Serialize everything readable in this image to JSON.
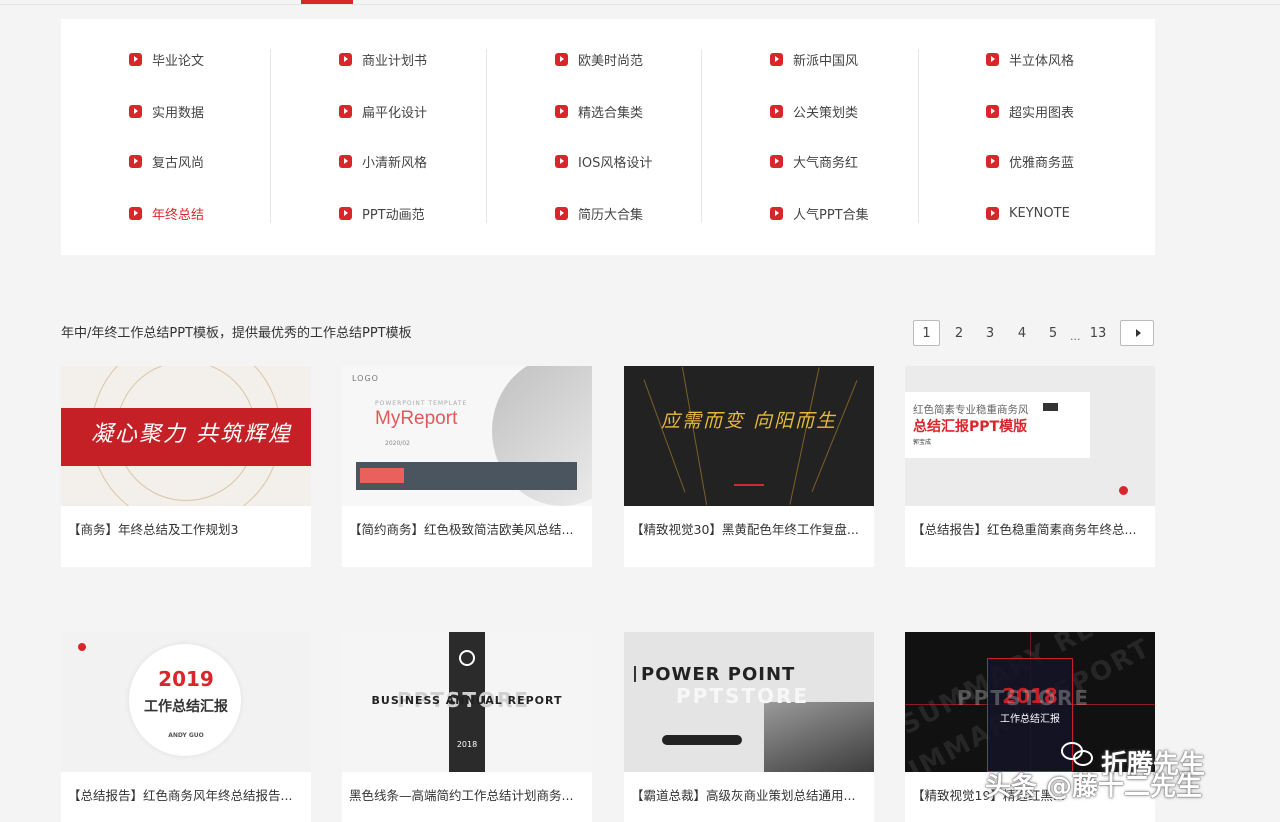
{
  "categories": [
    [
      {
        "label": "毕业论文"
      },
      {
        "label": "实用数据"
      },
      {
        "label": "复古风尚"
      },
      {
        "label": "年终总结",
        "active": true
      }
    ],
    [
      {
        "label": "商业计划书"
      },
      {
        "label": "扁平化设计"
      },
      {
        "label": "小清新风格"
      },
      {
        "label": "PPT动画范"
      }
    ],
    [
      {
        "label": "欧美时尚范"
      },
      {
        "label": "精选合集类"
      },
      {
        "label": "IOS风格设计"
      },
      {
        "label": "简历大合集"
      }
    ],
    [
      {
        "label": "新派中国风"
      },
      {
        "label": "公关策划类"
      },
      {
        "label": "大气商务红"
      },
      {
        "label": "人气PPT合集"
      }
    ],
    [
      {
        "label": "半立体风格"
      },
      {
        "label": "超实用图表"
      },
      {
        "label": "优雅商务蓝"
      },
      {
        "label": "KEYNOTE"
      }
    ]
  ],
  "section": {
    "title": "年中/年终工作总结PPT模板，提供最优秀的工作总结PPT模板"
  },
  "pagination": {
    "pages": [
      "1",
      "2",
      "3",
      "4",
      "5"
    ],
    "ellipsis": "...",
    "last": "13",
    "current": "1"
  },
  "cards": [
    {
      "title": "【商务】年终总结及工作规划3",
      "thumb": {
        "text": "凝心聚力 共筑辉煌"
      }
    },
    {
      "title": "【简约商务】红色极致简洁欧美风总结...",
      "thumb": {
        "logo": "LOGO",
        "sub": "POWERPOINT TEMPLATE",
        "big": "MyReport",
        "date": "2020/02"
      }
    },
    {
      "title": "【精致视觉30】黑黄配色年终工作复盘...",
      "thumb": {
        "text": "应需而变 向阳而生"
      }
    },
    {
      "title": "【总结报告】红色稳重简素商务年终总...",
      "thumb": {
        "line1": "红色简素专业稳重商务风",
        "line2": "总结汇报PPT模版",
        "name": "郭宝成"
      }
    },
    {
      "title": "【总结报告】红色商务风年终总结报告...",
      "thumb": {
        "year": "2019",
        "text": "工作总结汇报",
        "name": "ANDY GUO"
      }
    },
    {
      "title": "黑色线条—高端简约工作总结计划商务...",
      "thumb": {
        "text": "BUSINESS ANNUAL REPORT",
        "watermark": "PPTSTORE",
        "year": "2018"
      }
    },
    {
      "title": "【霸道总裁】高级灰商业策划总结通用...",
      "thumb": {
        "text": "POWER POINT",
        "watermark": "PPTSTORE"
      }
    },
    {
      "title": "【精致视觉19】精选红黑...",
      "thumb": {
        "year": "2018",
        "text": "工作总结汇报",
        "watermark": "PPTSTORE",
        "bg": "SUMMARY REPORT"
      }
    }
  ],
  "overlay": {
    "top": "折腾先生",
    "bottom": "头条 @藤十二先生"
  },
  "colors": {
    "accent": "#d9262b",
    "background": "#f4f4f4"
  }
}
